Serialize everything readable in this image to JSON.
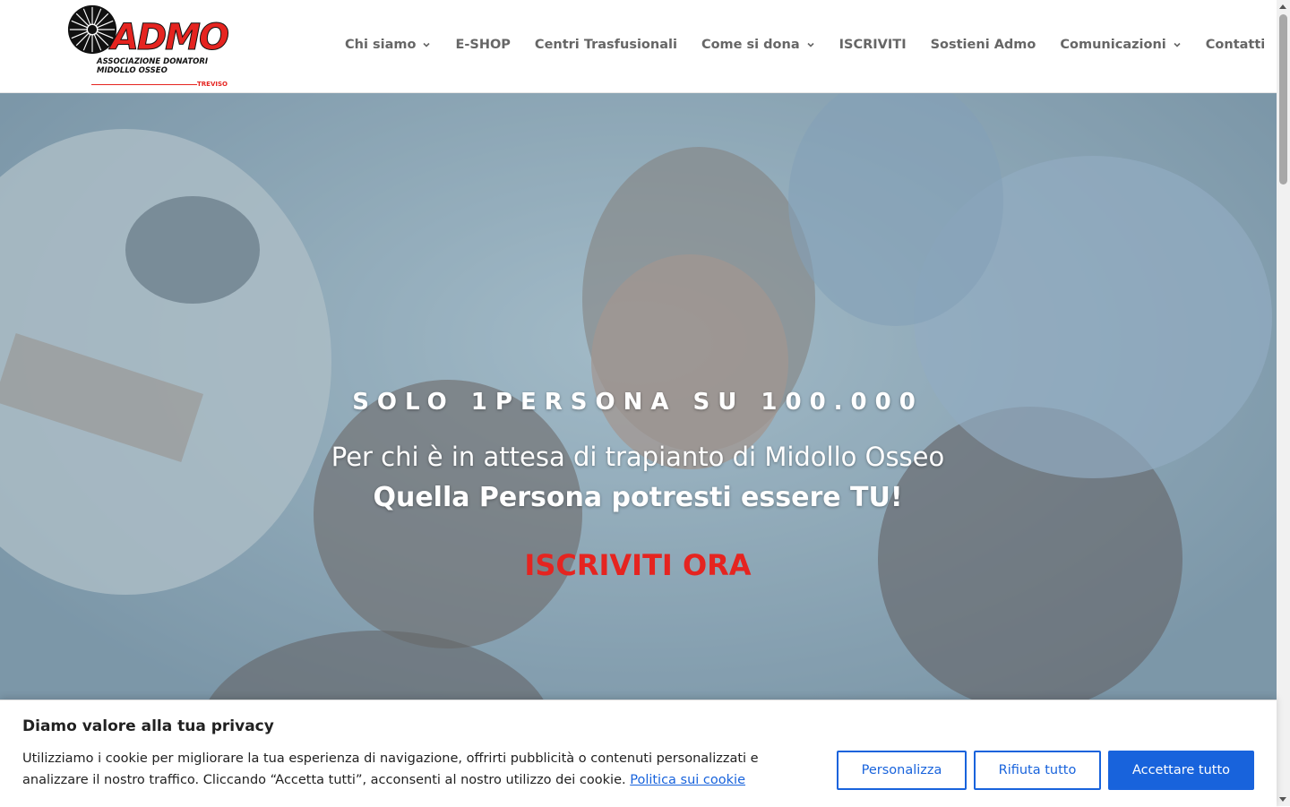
{
  "header": {
    "logo": {
      "brand": "ADMO",
      "line1": "ASSOCIAZIONE DONATORI",
      "line2": "MIDOLLO OSSEO",
      "city": "TREVISO",
      "wheel_icon": "bicycle-wheel-icon"
    },
    "nav": [
      {
        "label": "Chi siamo",
        "has_dropdown": true
      },
      {
        "label": "E-SHOP",
        "has_dropdown": false
      },
      {
        "label": "Centri Trasfusionali",
        "has_dropdown": false
      },
      {
        "label": "Come si dona",
        "has_dropdown": true
      },
      {
        "label": "ISCRIVITI",
        "has_dropdown": false
      },
      {
        "label": "Sostieni Admo",
        "has_dropdown": false
      },
      {
        "label": "Comunicazioni",
        "has_dropdown": true
      },
      {
        "label": "Contatti",
        "has_dropdown": false
      }
    ]
  },
  "hero": {
    "eyebrow": "SOLO 1PERSONA SU 100.000",
    "subtitle": "Per chi è in attesa di trapianto di Midollo Osseo",
    "bold_line": "Quella Persona potresti essere TU!",
    "cta": "ISCRIVITI ORA"
  },
  "cookie": {
    "title": "Diamo valore alla tua privacy",
    "text": "Utilizziamo i cookie per migliorare la tua esperienza di navigazione, offrirti pubblicità o contenuti personalizzati e analizzare il nostro traffico. Cliccando “Accetta tutti”, acconsenti al nostro utilizzo dei cookie.",
    "link": "Politica sui cookie",
    "buttons": {
      "customize": "Personalizza",
      "reject": "Rifiuta tutto",
      "accept": "Accettare tutto"
    }
  },
  "colors": {
    "brand_red": "#e52420",
    "cookie_blue": "#1863dc",
    "nav_text": "#666666"
  }
}
